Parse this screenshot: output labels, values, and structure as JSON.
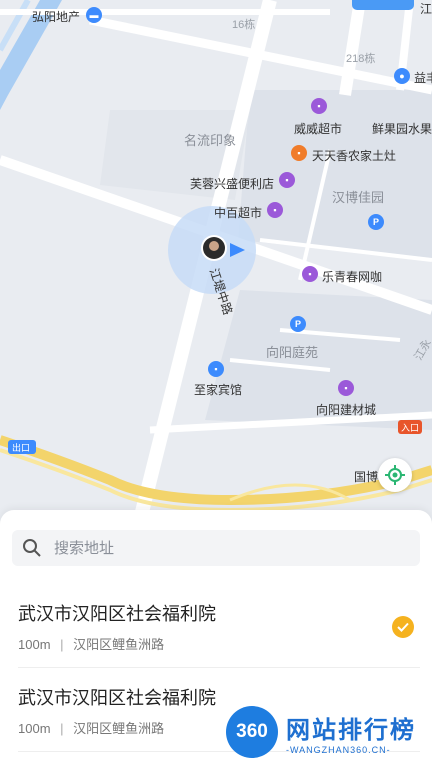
{
  "map": {
    "labels": {
      "hongyang": "弘阳地产",
      "bld16": "16栋",
      "bld218": "218栋",
      "yifeng": "益丰",
      "weiwei": "威威超市",
      "xianguoyuan": "鲜果园水果",
      "tiantian": "天天香农家土灶",
      "mingliu": "名流印象",
      "furong": "芙蓉兴盛便利店",
      "hanbo": "汉博佳园",
      "zhongbai": "中百超市",
      "jiangdi_road": "江堤中路",
      "leqingchun": "乐青春网咖",
      "xiangyang_court": "向阳庭苑",
      "zhijia": "至家宾馆",
      "xiangyang_mat": "向阳建材城",
      "exit_sign": "出口",
      "entrance_sign": "入口",
      "guobo": "国博",
      "jiangyong": "江永",
      "top_right": "江"
    }
  },
  "search": {
    "placeholder": "搜索地址",
    "value": ""
  },
  "results": [
    {
      "name": "武汉市汉阳区社会福利院",
      "distance": "100m",
      "address": "汉阳区鲤鱼洲路",
      "selected": true
    },
    {
      "name": "武汉市汉阳区社会福利院",
      "distance": "100m",
      "address": "汉阳区鲤鱼洲路",
      "selected": false
    }
  ],
  "watermark": {
    "logo": "360",
    "title": "网站排行榜",
    "subtitle": "-WANGZHAN360.CN-"
  },
  "colors": {
    "accent": "#f5b21f",
    "poi_purple": "#9b59d9",
    "poi_blue": "#3d8bfd",
    "poi_orange": "#f07c2a",
    "road_yellow": "#f3d46b"
  }
}
